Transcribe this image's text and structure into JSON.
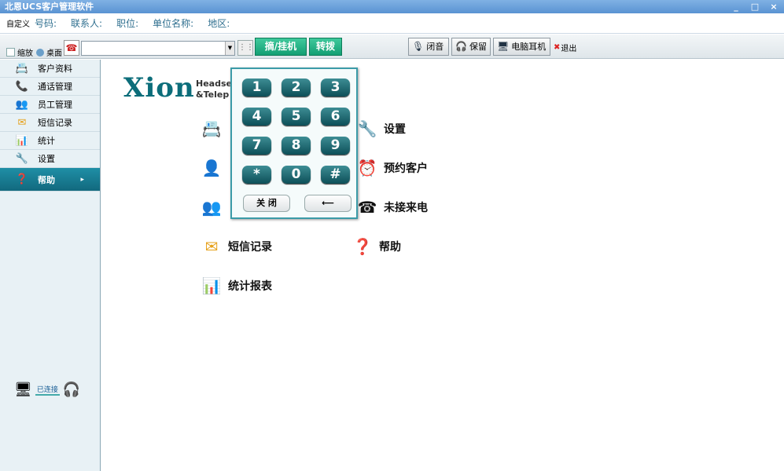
{
  "window": {
    "title": "北恩UCS客户管理软件",
    "minimize": "_",
    "restore": "□",
    "close": "×"
  },
  "infobar": {
    "custom": "自定义",
    "fields": [
      "号码:",
      "联系人:",
      "职位:",
      "单位名称:",
      "地区:"
    ]
  },
  "toolbar": {
    "minimize_check": "缩放",
    "desktop_check": "桌面",
    "dial_value": "",
    "hook_button": "摘/挂机",
    "transfer_button": "转拨",
    "mute_button": "闭音",
    "hold_button": "保留",
    "pc_headset_button": "电脑耳机",
    "exit_label": "退出"
  },
  "sidebar": {
    "items": [
      {
        "label": "客户资料",
        "icon": "contacts-icon"
      },
      {
        "label": "通话管理",
        "icon": "call-manage-icon"
      },
      {
        "label": "员工管理",
        "icon": "staff-icon"
      },
      {
        "label": "短信记录",
        "icon": "envelope-icon"
      },
      {
        "label": "统计",
        "icon": "bar-chart-icon"
      },
      {
        "label": "设置",
        "icon": "settings-icon"
      },
      {
        "label": "帮助",
        "icon": "help-icon",
        "active": true
      }
    ],
    "connection_status": "已连接"
  },
  "main": {
    "logo": "Xion",
    "logo_sub_1": "Headset",
    "logo_sub_2": "&Telep",
    "features": [
      {
        "label": "设置",
        "icon": "settings-icon"
      },
      {
        "label": "预约客户",
        "icon": "appointment-icon"
      },
      {
        "label": "未接来电",
        "icon": "missed-call-icon"
      },
      {
        "label": "短信记录",
        "icon": "envelope-icon"
      },
      {
        "label": "帮助",
        "icon": "help-icon"
      },
      {
        "label": "统计报表",
        "icon": "bar-chart-icon"
      }
    ]
  },
  "dialpad": {
    "keys": [
      "1",
      "2",
      "3",
      "4",
      "5",
      "6",
      "7",
      "8",
      "9",
      "*",
      "0",
      "#"
    ],
    "close_button": "关 闭",
    "backspace_button": "⟵"
  },
  "colors": {
    "accent": "#139f73",
    "active_nav": "#12697e",
    "dialpad_key": "#0d4f58"
  }
}
